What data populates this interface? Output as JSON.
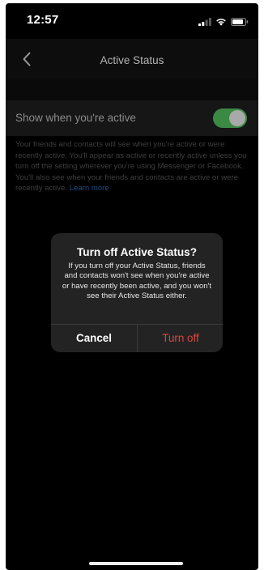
{
  "status_bar": {
    "time": "12:57",
    "icons": [
      "cellular-signal-icon",
      "wifi-icon",
      "battery-icon"
    ]
  },
  "header": {
    "title": "Active Status",
    "back_icon": "chevron-left-icon"
  },
  "setting": {
    "label": "Show when you're active",
    "toggle_on": true,
    "toggle_color": "#3a8a44"
  },
  "description": {
    "text": "Your friends and contacts will see when you're active or were recently active. You'll appear as active or recently active unless you turn off the setting wherever you're using Messenger or Facebook. You'll also see when your friends and contacts are active or were recently active.",
    "link": "Learn more"
  },
  "dialog": {
    "title": "Turn off Active Status?",
    "message": "If you turn off your Active Status, friends and contacts won't see when you're active or have recently been active, and you won't see their Active Status either.",
    "cancel_label": "Cancel",
    "confirm_label": "Turn off",
    "confirm_color": "#e1443d"
  }
}
